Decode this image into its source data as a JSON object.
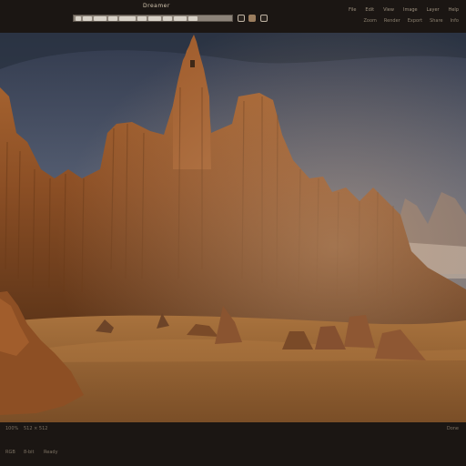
{
  "window": {
    "title": "Dreamer"
  },
  "menu_top": [
    "File",
    "Edit",
    "View",
    "Image",
    "Layer",
    "Help"
  ],
  "menu_top2": [
    "Zoom",
    "Render",
    "Export",
    "Share",
    "Info"
  ],
  "status": {
    "left": [
      "100%",
      "512 × 512",
      "RGB",
      "8-bit",
      "Ready"
    ],
    "right": "Done"
  },
  "icons": {
    "settings": "gear-icon",
    "palette": "palette-icon",
    "refresh": "refresh-icon"
  },
  "colors": {
    "chrome": "#1b1613",
    "sky_top": "#3d4658",
    "sand": "#9b6a3d"
  }
}
